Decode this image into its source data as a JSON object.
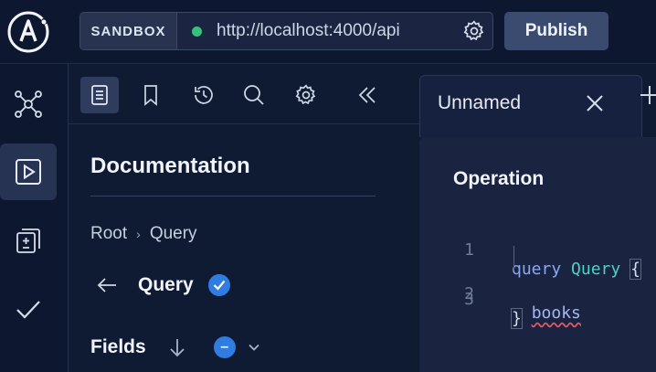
{
  "header": {
    "sandbox_label": "SANDBOX",
    "url": "http://localhost:4000/api",
    "publish_label": "Publish",
    "status_color": "#36c27a"
  },
  "rail": {
    "items": [
      {
        "icon": "schema-graph-icon"
      },
      {
        "icon": "explorer-play-icon",
        "active": true
      },
      {
        "icon": "changelog-icon"
      },
      {
        "icon": "checks-icon"
      }
    ]
  },
  "docs": {
    "title": "Documentation",
    "breadcrumb": [
      "Root",
      "Query"
    ],
    "current_type": "Query",
    "fields_label": "Fields"
  },
  "editor": {
    "tab_label": "Unnamed",
    "section_title": "Operation",
    "lines": [
      {
        "num": "1",
        "tokens": [
          "query",
          "Query",
          "{"
        ]
      },
      {
        "num": "2",
        "tokens": [
          "books"
        ]
      },
      {
        "num": "3",
        "tokens": [
          "}"
        ]
      }
    ]
  },
  "colors": {
    "accent": "#2f7de1",
    "background": "#0f1a33"
  }
}
